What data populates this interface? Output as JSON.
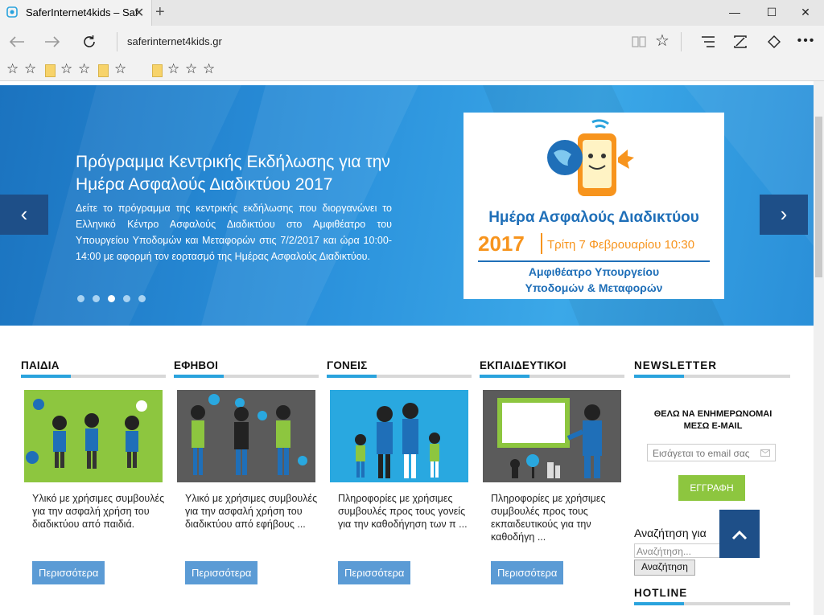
{
  "browser": {
    "tab_title": "SaferInternet4kids – Saf",
    "tab_close": "✕",
    "new_tab": "+",
    "win_minimize": "—",
    "win_maximize": "☐",
    "win_close": "✕",
    "url": "saferinternet4kids.gr",
    "icons": [
      "back-icon",
      "forward-icon",
      "refresh-icon",
      "reading-view-icon",
      "favorite-star-icon",
      "hub-icon",
      "web-note-icon",
      "share-icon",
      "more-icon"
    ]
  },
  "favorites_bar": {
    "items": [
      "☆",
      "☆",
      "folder",
      "☆",
      "☆",
      "folder",
      "☆",
      "twitter",
      "folder",
      "☆",
      "☆",
      "☆"
    ]
  },
  "hero": {
    "title": "Πρόγραμμα Κεντρικής Εκδήλωσης για την Ημέρα Ασφαλούς Διαδικτύου 2017",
    "description": "Δείτε το πρόγραμμα της κεντρικής εκδήλωσης που διοργανώνει το Ελληνικό Κέντρο Ασφαλούς Διαδικτύου στο Αμφιθέατρο του Υπουργείου Υποδομών και Μεταφορών στις 7/2/2017 και ώρα 10:00-14:00 με αφορμή τον εορτασμό της Ημέρας Ασφαλούς Διαδικτύου.",
    "prev": "‹",
    "next": "›",
    "active_dot": 2,
    "dot_count": 5,
    "poster": {
      "line1": "Ημέρα Ασφαλούς Διαδικτύου",
      "year": "2017",
      "date": "Τρίτη 7 Φεβρουαρίου 10:30",
      "venue1": "Αμφιθέατρο Υπουργείου",
      "venue2": "Υποδομών & Μεταφορών"
    }
  },
  "categories": [
    {
      "heading": "ΠΑΙΔΙΑ",
      "text": "Υλικό με χρήσιμες συμβουλές για την ασφαλή χρήση του διαδικτύου από παιδιά.",
      "button": "Περισσότερα",
      "bg": "#8dc63f"
    },
    {
      "heading": "ΕΦΗΒΟΙ",
      "text": "Υλικό με χρήσιμες συμβουλές για την ασφαλή χρήση του διαδικτύου από εφήβους ...",
      "button": "Περισσότερα",
      "bg": "#5b5b5b"
    },
    {
      "heading": "ΓΟΝΕΙΣ",
      "text": "Πληροφορίες με χρήσιμες συμβουλές προς τους γονείς για την καθοδήγηση των π ...",
      "button": "Περισσότερα",
      "bg": "#29a8e0"
    },
    {
      "heading": "ΕΚΠΑΙΔΕΥΤΙΚΟΙ",
      "text": "Πληροφορίες με χρήσιμες συμβουλές προς τους εκπαιδευτικούς για την καθοδήγη ...",
      "button": "Περισσότερα",
      "bg": "#5b5b5b"
    }
  ],
  "newsletter": {
    "heading": "NEWSLETTER",
    "subtitle": "ΘΕΛΩ ΝΑ ΕΝΗΜΕΡΩΝΟΜΑΙ ΜΕΣΩ E-MAIL",
    "email_placeholder": "Εισάγεται το email σας",
    "subscribe": "ΕΓΓΡΑΦΗ",
    "search_title": "Αναζήτηση για",
    "search_placeholder": "Αναζήτηση...",
    "search_button": "Αναζήτηση",
    "to_top": "⌃"
  },
  "hotline": {
    "heading": "HOTLINE"
  },
  "colors": {
    "accent": "#2aa3dd",
    "button": "#5b9bd5",
    "subscribe": "#8dc63f",
    "dark_blue": "#1e4f88"
  }
}
